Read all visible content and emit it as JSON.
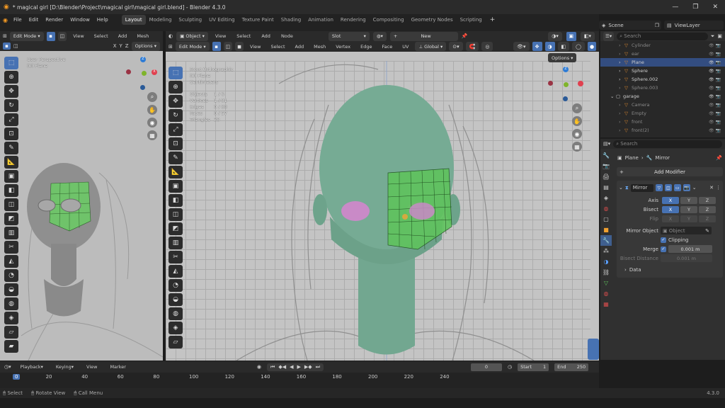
{
  "title": "* magical girl [D:\\Blender\\Project\\magical girl\\magical girl.blend] - Blender 4.3.0",
  "menus": [
    "File",
    "Edit",
    "Render",
    "Window",
    "Help"
  ],
  "workspaces": [
    "Layout",
    "Modeling",
    "Sculpting",
    "UV Editing",
    "Texture Paint",
    "Shading",
    "Animation",
    "Rendering",
    "Compositing",
    "Geometry Nodes",
    "Scripting"
  ],
  "active_workspace": "Layout",
  "scene": "Scene",
  "view_layer": "ViewLayer",
  "left_view": {
    "mode": "Edit Mode",
    "menus": [
      "View",
      "Select",
      "Add",
      "Mesh"
    ],
    "axes": [
      "X",
      "Y",
      "Z"
    ],
    "options": "Options",
    "overlay": [
      "User Perspective",
      "(0) Plane"
    ]
  },
  "shader_header": {
    "object": "Object",
    "menus": [
      "View",
      "Select",
      "Add",
      "Node"
    ],
    "slot": "Slot",
    "new": "New"
  },
  "main_view": {
    "mode": "Edit Mode",
    "menus": [
      "View",
      "Select",
      "Add",
      "Mesh",
      "Vertex",
      "Edge",
      "Face",
      "UV"
    ],
    "transform": "Global",
    "options": "Options",
    "overlay": [
      "Front Orthographic",
      "(0) Plane",
      "Centimeters"
    ],
    "stats": [
      {
        "label": "Objects",
        "value": "1 / 6"
      },
      {
        "label": "Vertices",
        "value": "1 / 81"
      },
      {
        "label": "Edges",
        "value": "0 / 80"
      },
      {
        "label": "Faces",
        "value": "0 / 57"
      },
      {
        "label": "Triangles",
        "value": "38"
      }
    ]
  },
  "outliner": {
    "search": "Search",
    "rows": [
      {
        "name": "Cylinder",
        "indent": 1,
        "dim": true
      },
      {
        "name": "ear",
        "indent": 1,
        "dim": true
      },
      {
        "name": "Plane",
        "indent": 1,
        "selected": true
      },
      {
        "name": "Sphere",
        "indent": 1
      },
      {
        "name": "Sphere.002",
        "indent": 1
      },
      {
        "name": "Sphere.003",
        "indent": 1,
        "dim": true
      },
      {
        "name": "garage",
        "indent": 0
      },
      {
        "name": "Camera",
        "indent": 1,
        "dim": true
      },
      {
        "name": "Empty",
        "indent": 1,
        "dim": true
      },
      {
        "name": "front",
        "indent": 1,
        "dim": true
      },
      {
        "name": "front(2)",
        "indent": 1,
        "dim": true
      }
    ]
  },
  "properties": {
    "search": "Search",
    "breadcrumb": [
      "Plane",
      "Mirror"
    ],
    "add_modifier": "Add Modifier",
    "modifier_name": "Mirror",
    "axis_label": "Axis",
    "bisect_label": "Bisect",
    "flip_label": "Flip",
    "axes": [
      "X",
      "Y",
      "Z"
    ],
    "mirror_object_label": "Mirror Object",
    "mirror_object_placeholder": "Object",
    "clipping_label": "Clipping",
    "merge_label": "Merge",
    "merge_value": "0.001 m",
    "bisect_distance_label": "Bisect Distance",
    "bisect_distance_value": "0.001 m",
    "data_label": "Data"
  },
  "timeline": {
    "menus": [
      "Playback",
      "Keying",
      "View",
      "Marker"
    ],
    "current_frame": "0",
    "start_label": "Start",
    "start": "1",
    "end_label": "End",
    "end": "250",
    "ticks": [
      "0",
      "20",
      "40",
      "60",
      "80",
      "100",
      "120",
      "140",
      "160",
      "180",
      "200",
      "220",
      "240"
    ]
  },
  "statusbar": {
    "items": [
      "Select",
      "Rotate View",
      "Call Menu"
    ],
    "version": "4.3.0"
  }
}
